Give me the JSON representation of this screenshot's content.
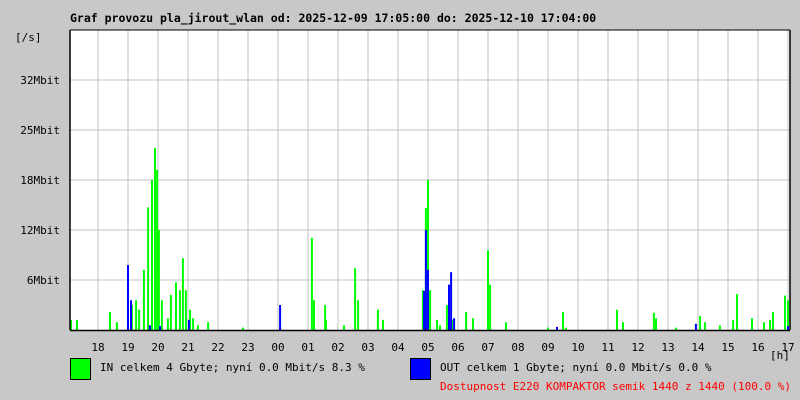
{
  "title": "Graf provozu pla_jirout_wlan od: 2025-12-09 17:05:00 do: 2025-12-10 17:04:00",
  "legend": {
    "in_text": "IN celkem 4 Gbyte; nyní    0.0 Mbit/s 8.3 %",
    "out_text": "OUT celkem 1 Gbyte; nyní    0.0 Mbit/s 0.0 %",
    "availability": "Dostupnost E220 KOMPAKTOR semik 1440 z 1440 (100.0 %)"
  },
  "colors": {
    "in": "#00ff00",
    "out": "#0000ff",
    "availability": "#ff0000",
    "grid": "#c0c0c0"
  },
  "chart_data": {
    "type": "bar",
    "title": "Graf provozu pla_jirout_wlan od: 2025-12-09 17:05:00 do: 2025-12-10 17:04:00",
    "ylabel": "[/s]",
    "xlabel": "[h]",
    "x_unit": "hours since 2025-12-09 17:00",
    "xlim": [
      0.08,
      24.07
    ],
    "ylim": [
      0,
      38.4
    ],
    "y_unit": "Mbit/s",
    "grid": true,
    "yticks": [
      {
        "v": 6.4,
        "label": "6Mbit"
      },
      {
        "v": 12.8,
        "label": "12Mbit"
      },
      {
        "v": 19.2,
        "label": "18Mbit"
      },
      {
        "v": 25.6,
        "label": "25Mbit"
      },
      {
        "v": 32.0,
        "label": "32Mbit"
      }
    ],
    "xticks": [
      "18",
      "19",
      "20",
      "21",
      "22",
      "23",
      "00",
      "01",
      "02",
      "03",
      "04",
      "05",
      "06",
      "07",
      "08",
      "09",
      "10",
      "11",
      "12",
      "13",
      "14",
      "15",
      "16",
      "17"
    ],
    "series": [
      {
        "name": "IN",
        "color": "#00ff00",
        "points": [
          [
            0.1,
            1.3
          ],
          [
            0.3,
            1.3
          ],
          [
            1.4,
            2.3
          ],
          [
            1.63,
            1.0
          ],
          [
            2.0,
            1.9
          ],
          [
            2.13,
            3.2
          ],
          [
            2.27,
            3.8
          ],
          [
            2.37,
            2.6
          ],
          [
            2.53,
            7.7
          ],
          [
            2.67,
            15.7
          ],
          [
            2.8,
            19.2
          ],
          [
            2.9,
            23.3
          ],
          [
            2.97,
            20.5
          ],
          [
            3.03,
            12.8
          ],
          [
            3.13,
            3.8
          ],
          [
            3.33,
            1.5
          ],
          [
            3.43,
            4.5
          ],
          [
            3.6,
            6.1
          ],
          [
            3.73,
            5.1
          ],
          [
            3.83,
            9.2
          ],
          [
            3.93,
            5.1
          ],
          [
            4.07,
            2.6
          ],
          [
            4.17,
            1.5
          ],
          [
            4.33,
            0.6
          ],
          [
            4.67,
            1.0
          ],
          [
            5.83,
            0.3
          ],
          [
            7.07,
            0.3
          ],
          [
            8.13,
            11.8
          ],
          [
            8.2,
            3.8
          ],
          [
            8.57,
            3.2
          ],
          [
            8.6,
            1.3
          ],
          [
            9.2,
            0.6
          ],
          [
            9.57,
            7.9
          ],
          [
            9.67,
            3.8
          ],
          [
            10.33,
            2.6
          ],
          [
            10.5,
            1.3
          ],
          [
            11.83,
            5.1
          ],
          [
            11.93,
            15.6
          ],
          [
            12.0,
            19.2
          ],
          [
            12.07,
            5.1
          ],
          [
            12.3,
            1.3
          ],
          [
            12.4,
            0.6
          ],
          [
            12.63,
            3.2
          ],
          [
            12.8,
            1.3
          ],
          [
            13.27,
            2.3
          ],
          [
            13.5,
            1.5
          ],
          [
            14.0,
            10.2
          ],
          [
            14.07,
            5.8
          ],
          [
            14.6,
            1.0
          ],
          [
            16.0,
            0.3
          ],
          [
            16.5,
            2.3
          ],
          [
            16.6,
            0.3
          ],
          [
            18.3,
            2.6
          ],
          [
            18.5,
            1.0
          ],
          [
            19.53,
            2.2
          ],
          [
            19.6,
            1.5
          ],
          [
            20.27,
            0.3
          ],
          [
            21.07,
            1.8
          ],
          [
            21.23,
            1.0
          ],
          [
            21.73,
            0.6
          ],
          [
            22.17,
            1.3
          ],
          [
            22.3,
            4.6
          ],
          [
            22.8,
            1.5
          ],
          [
            23.2,
            1.0
          ],
          [
            23.4,
            1.3
          ],
          [
            23.5,
            2.3
          ],
          [
            23.9,
            4.4
          ],
          [
            24.0,
            3.8
          ]
        ]
      },
      {
        "name": "OUT",
        "color": "#0000ff",
        "points": [
          [
            2.0,
            8.3
          ],
          [
            2.1,
            3.8
          ],
          [
            2.73,
            0.6
          ],
          [
            3.07,
            0.5
          ],
          [
            4.03,
            1.3
          ],
          [
            7.07,
            3.2
          ],
          [
            11.87,
            5.0
          ],
          [
            11.93,
            12.8
          ],
          [
            12.0,
            7.7
          ],
          [
            12.7,
            5.8
          ],
          [
            12.77,
            7.4
          ],
          [
            12.87,
            1.5
          ],
          [
            16.3,
            0.4
          ],
          [
            20.93,
            0.8
          ],
          [
            24.0,
            0.5
          ]
        ]
      }
    ]
  }
}
